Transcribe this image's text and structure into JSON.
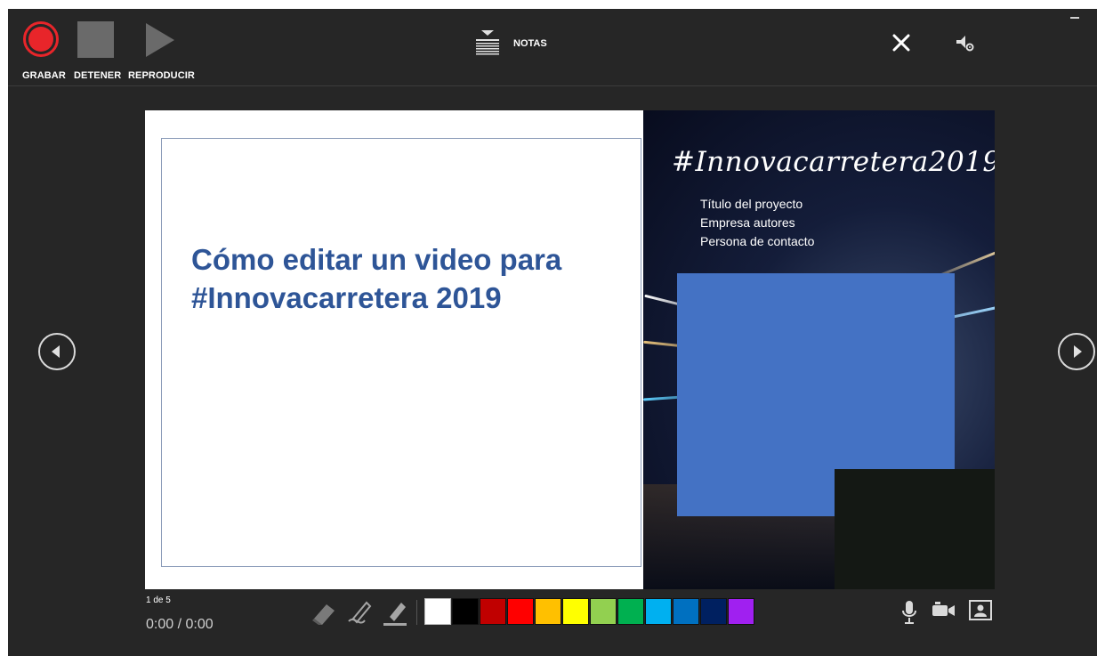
{
  "toolbar": {
    "record_label": "GRABAR",
    "stop_label": "DETENER",
    "play_label": "REPRODUCIR",
    "notes_label": "NOTAS",
    "record_color": "#e8252a"
  },
  "slide": {
    "title": "Cómo editar un video para #Innovacarretera 2019",
    "hashtag": "#Innovacarretera2019",
    "lines": [
      "Título del proyecto",
      "Empresa autores",
      "Persona de contacto"
    ],
    "title_color": "#2e5597",
    "placeholder_color": "#4472c4"
  },
  "footer": {
    "slide_counter": "1 de 5",
    "timer": "0:00 / 0:00",
    "pen_colors": [
      "#ffffff",
      "#000000",
      "#c00000",
      "#ff0000",
      "#ffc000",
      "#ffff00",
      "#92d050",
      "#00b050",
      "#00b0f0",
      "#0070c0",
      "#002060",
      "#a020f0"
    ]
  },
  "icons": [
    "record-icon",
    "stop-icon",
    "play-icon",
    "notes-icon",
    "close-icon",
    "settings-icon",
    "previous-slide-icon",
    "next-slide-icon",
    "eraser-icon",
    "pen-icon",
    "highlighter-icon",
    "microphone-icon",
    "camera-icon",
    "camera-preview-icon"
  ]
}
